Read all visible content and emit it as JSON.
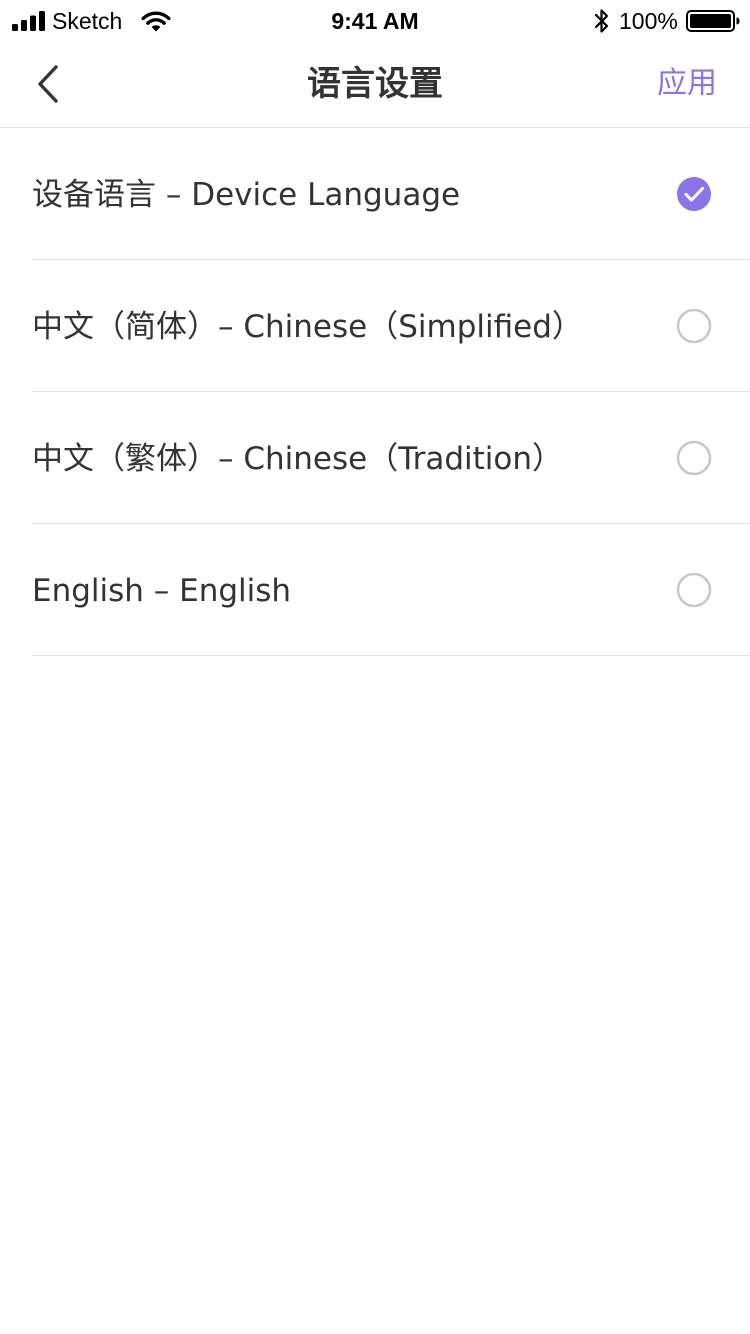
{
  "status_bar": {
    "carrier": "Sketch",
    "time": "9:41 AM",
    "battery": "100%"
  },
  "nav": {
    "title": "语言设置",
    "apply_label": "应用"
  },
  "languages": [
    {
      "label": "设备语言 – Device Language",
      "selected": true
    },
    {
      "label": "中文（简体）– Chinese（Simplified）",
      "selected": false
    },
    {
      "label": "中文（繁体）– Chinese（Tradition）",
      "selected": false
    },
    {
      "label": "English – English",
      "selected": false
    }
  ],
  "colors": {
    "accent": "#8b73ea",
    "divider": "#e2e2e2",
    "radio_border": "#c8c8c8",
    "text": "#333333"
  },
  "icons": {
    "back": "chevron-left-icon",
    "selected": "check-circle-icon",
    "unselected": "radio-empty-icon"
  }
}
